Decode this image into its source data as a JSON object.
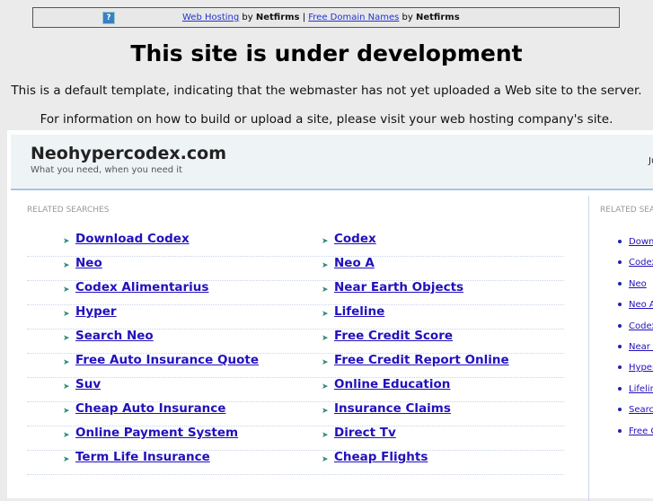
{
  "topbar": {
    "link1": "Web Hosting",
    "by1": "by",
    "brand1": "Netfirms",
    "sep": "|",
    "link2": "Free Domain Names",
    "by2": "by",
    "brand2": "Netfirms",
    "help_icon": "?"
  },
  "title": "This site is under development",
  "line1": "This is a default template, indicating that the webmaster has not yet uploaded a Web site to the server.",
  "line2": "For information on how to build or upload a site, please visit your web hosting company's site.",
  "site": {
    "name": "Neohypercodex.com",
    "tagline": "What you need, when you need it",
    "right_text": "Ju"
  },
  "related_label": "RELATED SEARCHES",
  "left_col": [
    "Download Codex",
    "Neo",
    "Codex Alimentarius",
    "Hyper",
    "Search Neo",
    "Free Auto Insurance Quote",
    "Suv",
    "Cheap Auto Insurance",
    "Online Payment System",
    "Term Life Insurance"
  ],
  "right_col": [
    "Codex",
    "Neo A",
    "Near Earth Objects",
    "Lifeline",
    "Free Credit Score",
    "Free Credit Report Online",
    "Online Education",
    "Insurance Claims",
    "Direct Tv",
    "Cheap Flights"
  ],
  "sidebar_label": "RELATED SEARCHES",
  "sidebar": [
    "Download Codex",
    "Codex",
    "Neo",
    "Neo A",
    "Codex Alimentarius",
    "Near Earth Objects",
    "Hyper",
    "Lifeline",
    "Search Neo",
    "Free Credit Score"
  ]
}
